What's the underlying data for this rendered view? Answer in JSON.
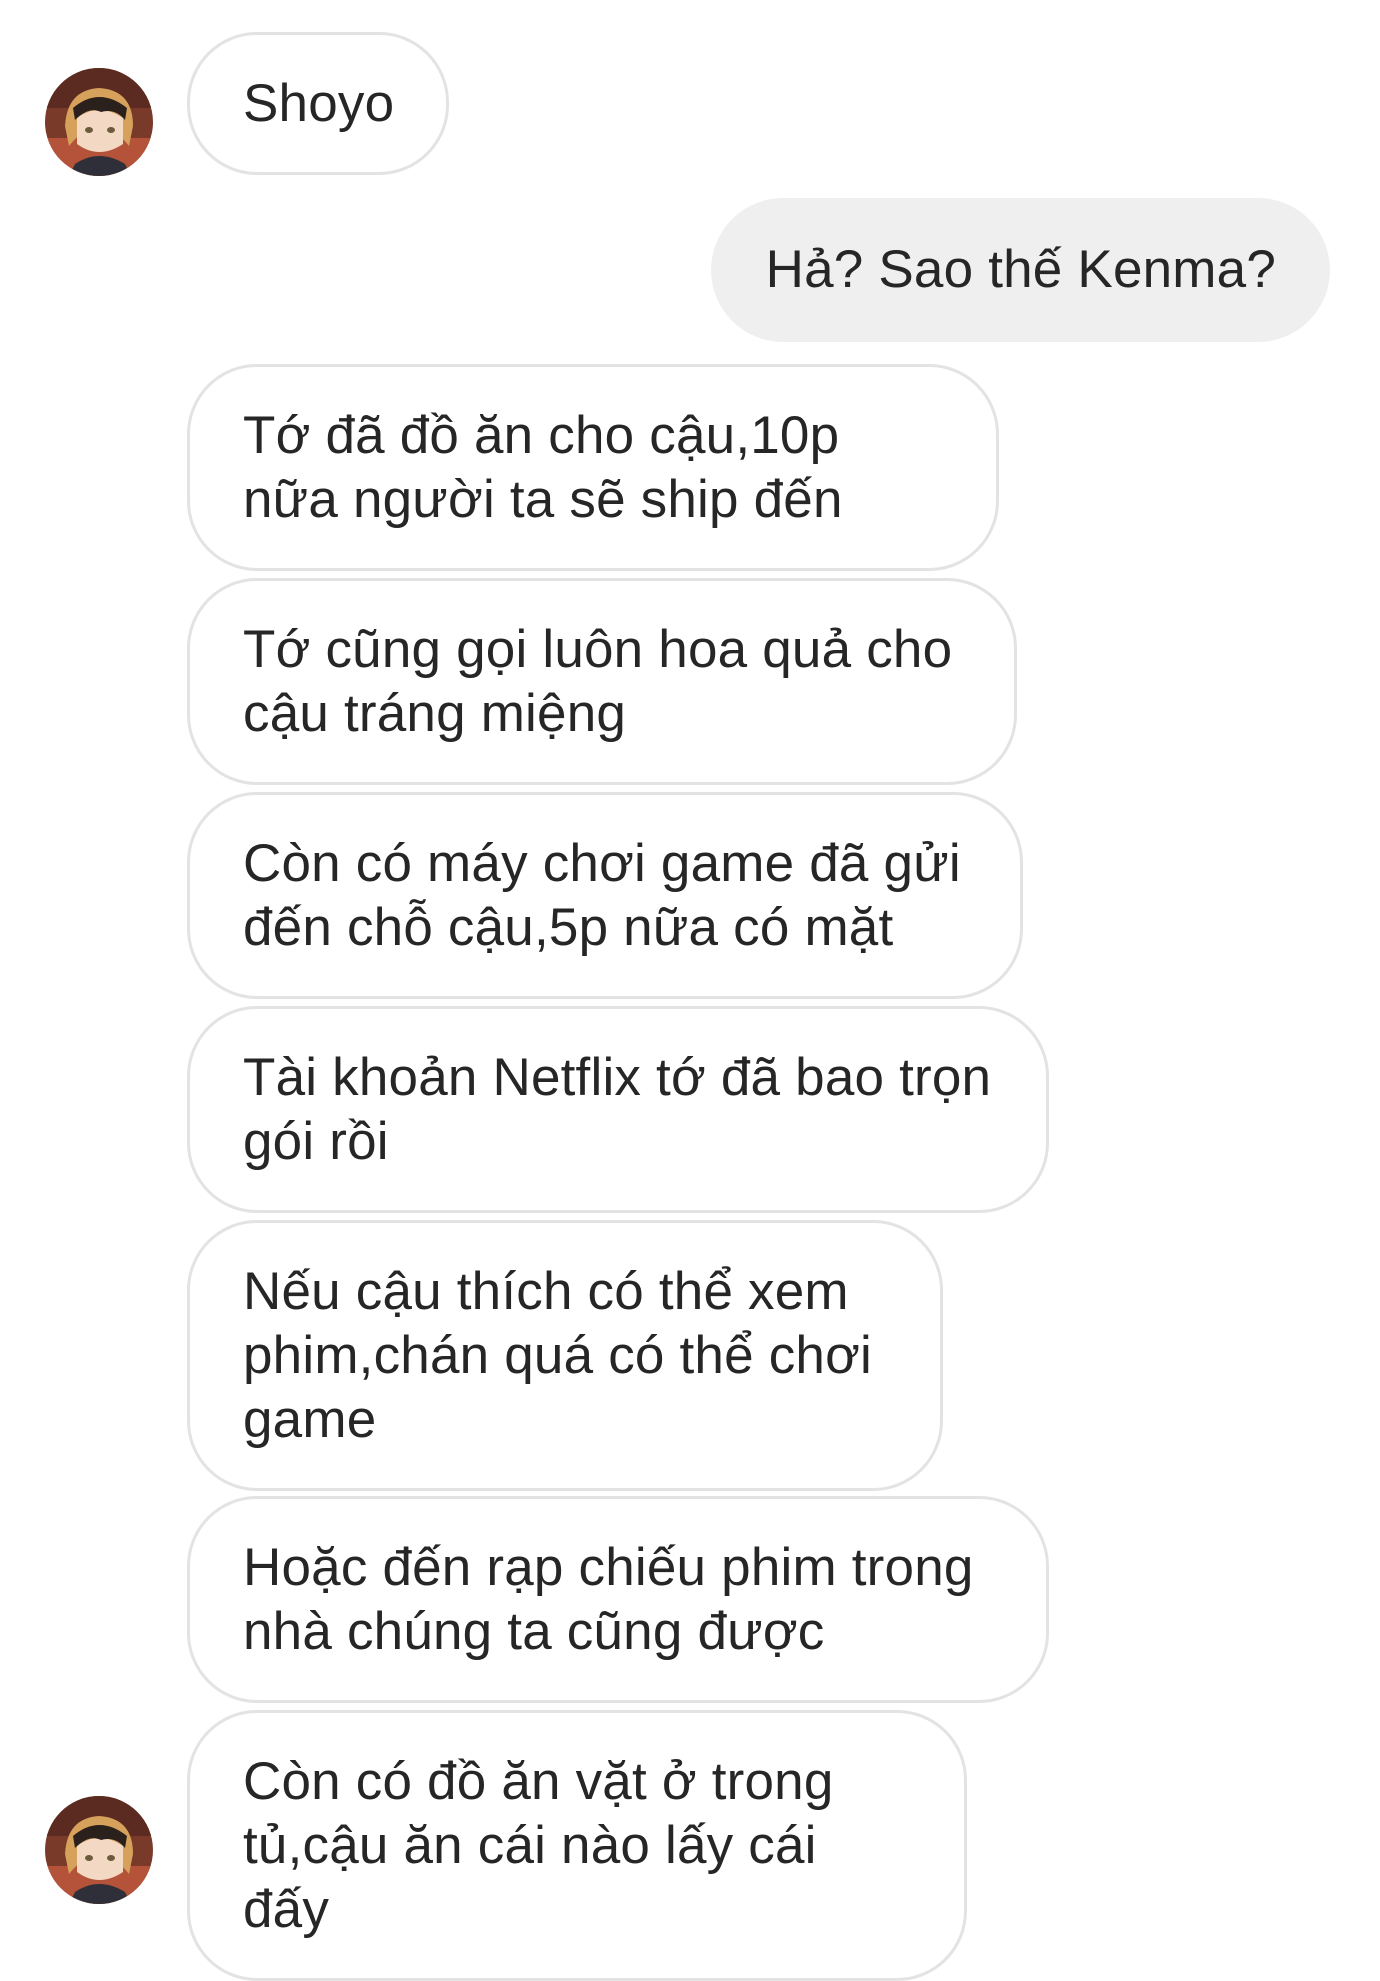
{
  "conversation": {
    "contact_avatar_icon": "kenma-avatar-icon",
    "messages": [
      {
        "sender": "contact",
        "text": "Shoyo"
      },
      {
        "sender": "self",
        "text": "Hả? Sao thế Kenma?"
      },
      {
        "sender": "contact",
        "text": "Tớ đã đồ ăn cho cậu,10p nữa người ta sẽ ship đến"
      },
      {
        "sender": "contact",
        "text": "Tớ cũng gọi luôn hoa quả cho cậu tráng miệng"
      },
      {
        "sender": "contact",
        "text": "Còn có máy chơi game đã gửi đến chỗ cậu,5p nữa có mặt"
      },
      {
        "sender": "contact",
        "text": "Tài khoản Netflix tớ đã bao trọn gói rồi"
      },
      {
        "sender": "contact",
        "text": "Nếu cậu thích có thể xem phim,chán quá có thể chơi game"
      },
      {
        "sender": "contact",
        "text": "Hoặc đến rạp chiếu phim trong nhà chúng ta cũng được"
      },
      {
        "sender": "contact",
        "text": "Còn có đồ ăn vặt ở trong tủ,cậu ăn cái nào lấy cái đấy"
      }
    ]
  },
  "colors": {
    "incoming_bubble_border": "#e3e3e3",
    "outgoing_bubble_bg": "#efefef",
    "text": "#262626"
  }
}
